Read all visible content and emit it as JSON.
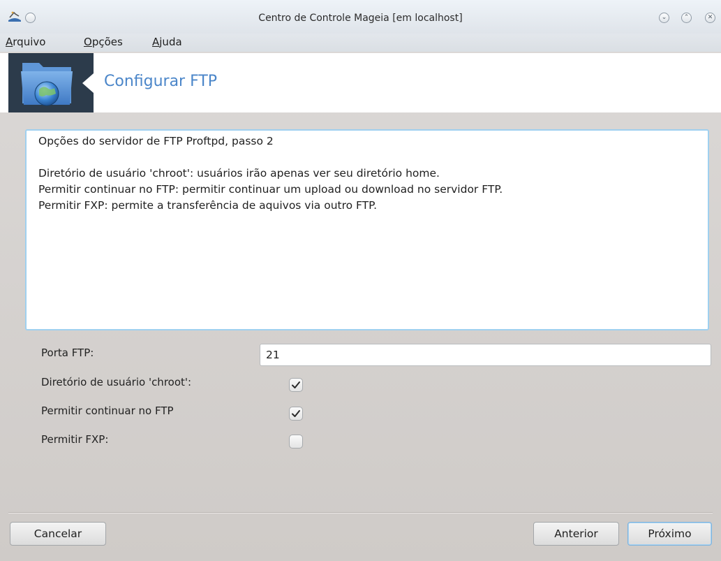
{
  "window": {
    "title": "Centro de Controle Mageia  [em localhost]"
  },
  "menubar": {
    "items": [
      {
        "first": "A",
        "rest": "rquivo"
      },
      {
        "first": "O",
        "rest": "pções"
      },
      {
        "first": "A",
        "rest": "juda"
      }
    ]
  },
  "banner": {
    "title": "Configurar FTP",
    "icon": "ftp-folder-globe-icon"
  },
  "info": {
    "lines": [
      "Opções do servidor de FTP Proftpd, passo 2",
      "",
      "Diretório de usuário 'chroot': usuários irão apenas ver seu diretório home.",
      "Permitir continuar no FTP: permitir continuar um upload ou download no servidor FTP.",
      "Permitir FXP: permite a transferência de aquivos via outro FTP."
    ]
  },
  "form": {
    "port_label": "Porta FTP:",
    "port_value": "21",
    "chroot_label": "Diretório de usuário 'chroot':",
    "chroot_checked": true,
    "resume_label": "Permitir continuar no FTP",
    "resume_checked": true,
    "fxp_label": "Permitir FXP:",
    "fxp_checked": false
  },
  "buttons": {
    "cancel": "Cancelar",
    "previous": "Anterior",
    "next": "Próximo"
  },
  "colors": {
    "accent": "#4b86c9",
    "banner_icon_bg": "#2c3b4b",
    "focus_border": "#9fd0ef"
  }
}
